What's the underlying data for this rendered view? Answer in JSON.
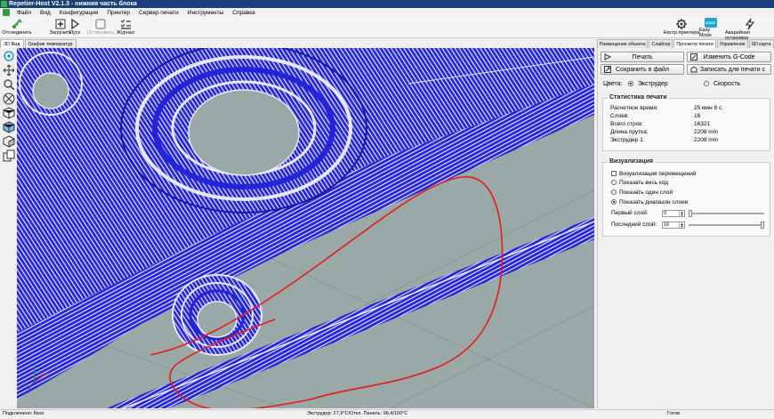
{
  "window": {
    "title": "Repetier-Host V2.1.3 - нижняя часть блока"
  },
  "menu": {
    "items": [
      "Файл",
      "Вид",
      "Конфигурация",
      "Принтер",
      "Сервер печати",
      "Инструменты",
      "Справка"
    ]
  },
  "toolbar": {
    "disconnect_label": "Отсоединить",
    "load_label": "Загрузить",
    "start_label": "Пуск",
    "stop_label": "Остановить",
    "log_label": "Журнал",
    "printer_settings_label": "Настр.принтера",
    "easy_mode_label": "Easy Mode",
    "easy_badge": "EASY",
    "emergency_label": "Аварийная остановка"
  },
  "left_tabs": [
    "3D Вид",
    "График температур"
  ],
  "right_tabs": [
    "Размещение объекта",
    "Слайсер",
    "Просмотр печати",
    "Управление",
    "SD карта"
  ],
  "panel": {
    "print_button": "Печать",
    "edit_gcode_button": "Изменить G-Code",
    "save_file_button": "Сохранить в файл",
    "write_print_button": "Записать для печати с",
    "colors_label": "Цвета:",
    "colors_option_extruder": "Экструдер",
    "colors_option_speed": "Скорость",
    "stats": {
      "title": "Статистика печати",
      "rows": [
        {
          "label": "Расчетное время:",
          "value": "25 мин 8 с"
        },
        {
          "label": "Слоев:",
          "value": "16"
        },
        {
          "label": "Всего строк:",
          "value": "16321"
        },
        {
          "label": "Длина прутка:",
          "value": "2208 mm"
        },
        {
          "label": "Экструдер 1",
          "value": "2208 mm"
        }
      ]
    },
    "visualization": {
      "title": "Визуализация",
      "show_travel": "Визуализация перемещений",
      "show_all_code": "Показать весь код",
      "show_one_layer": "Показать один слой",
      "show_layer_range": "Показать диапазон слоев",
      "first_layer_label": "Первый слой:",
      "first_layer_value": "0",
      "last_layer_label": "Последний слой:",
      "last_layer_value": "16",
      "first_layer_fraction": 0.0,
      "last_layer_fraction": 1.0
    }
  },
  "status": {
    "connection": "Подключено: flsun",
    "temperatures": "Экструдер: 27,9°C/Откл. Панель: 98,4/100°C",
    "ready": "Готов"
  },
  "colors": {
    "title_bar": "#1b3f7a",
    "print_lines": "#2424d8",
    "highlight": "#e8e8ff",
    "annotation": "#e41d1d",
    "background_3d": "#9aa8a8"
  },
  "icons": {
    "side_tools": [
      "rotate-view-icon",
      "move-view-icon",
      "zoom-view-icon",
      "front-view-icon",
      "iso-view-icon",
      "top-view-icon",
      "side-view-icon",
      "objects-view-icon"
    ]
  }
}
